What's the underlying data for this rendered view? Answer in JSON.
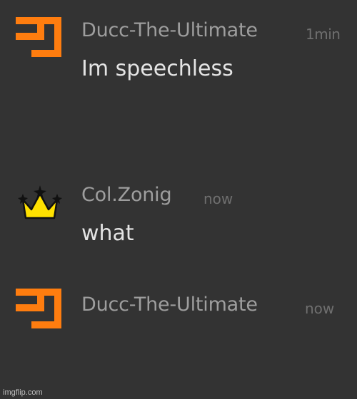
{
  "messages": [
    {
      "avatar_icon": "orange-block-logo-icon",
      "username": "Ducc-The-Ultimate",
      "time": "1min",
      "text": "Im speechless"
    },
    {
      "avatar_icon": "crown-icon",
      "username": "Col.Zonig",
      "time": "now",
      "text": "what"
    },
    {
      "avatar_icon": "orange-block-logo-icon",
      "username": "Ducc-The-Ultimate",
      "time": "now",
      "text": ""
    }
  ],
  "watermark": "imgflip.com",
  "colors": {
    "background": "#333333",
    "username": "#9e9e9e",
    "timestamp": "#6f6f6f",
    "message_text": "#e4e4e4",
    "avatar_orange": "#ff7d0f",
    "crown_yellow": "#ffe100"
  }
}
